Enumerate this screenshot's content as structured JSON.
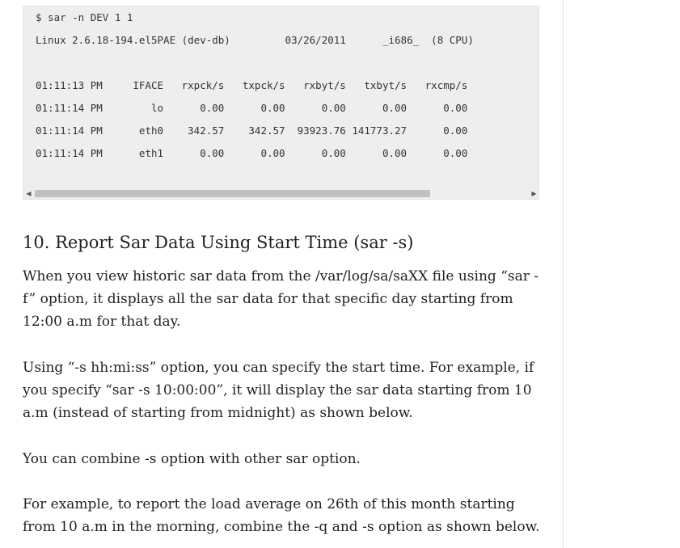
{
  "code": {
    "lines": [
      "$ sar -n DEV 1 1",
      "Linux 2.6.18-194.el5PAE (dev-db)         03/26/2011      _i686_  (8 CPU)",
      "",
      "01:11:13 PM     IFACE   rxpck/s   txpck/s   rxbyt/s   txbyt/s   rxcmp/s",
      "01:11:14 PM        lo      0.00      0.00      0.00      0.00      0.00",
      "01:11:14 PM      eth0    342.57    342.57  93923.76 141773.27      0.00",
      "01:11:14 PM      eth1      0.00      0.00      0.00      0.00      0.00"
    ]
  },
  "scrollbar": {
    "left_arrow": "◀",
    "right_arrow": "▶",
    "position_fraction": 0
  },
  "article": {
    "heading": "10. Report Sar Data Using Start Time (sar -s)",
    "paragraphs": [
      "When you view historic sar data from the /var/log/sa/saXX file using “sar -f” option, it displays all the sar data for that specific day starting from 12:00 a.m for that day.",
      "Using “-s hh:mi:ss” option, you can specify the start time. For example, if you specify “sar -s 10:00:00”, it will display the sar data starting from 10 a.m (instead of starting from midnight) as shown below.",
      "You can combine -s option with other sar option.",
      "For example, to report the load average on 26th of this month starting from 10 a.m in the morning, combine the -q and -s option as shown below."
    ]
  }
}
